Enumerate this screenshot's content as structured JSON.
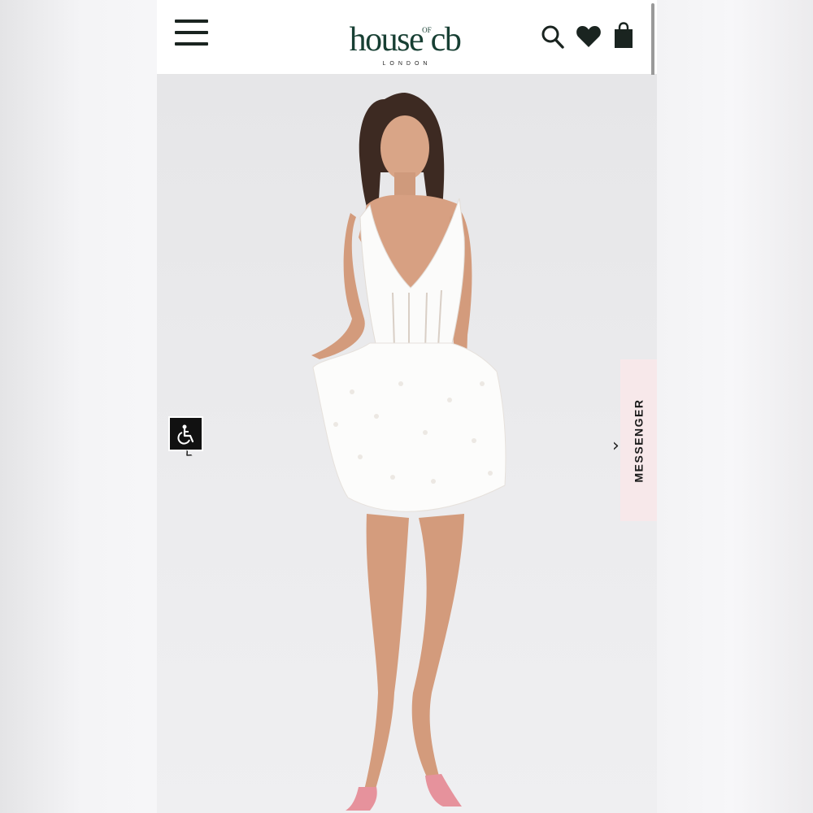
{
  "header": {
    "logo_text": "house",
    "logo_of": "OF",
    "logo_text_end": "cb",
    "logo_sub": "LONDON",
    "icons": [
      "menu-icon",
      "search-icon",
      "heart-icon",
      "shopping-bag-icon"
    ]
  },
  "product": {
    "image_alt": "Model wearing white broderie mini dress with corset bodice"
  },
  "widgets": {
    "messenger_label": "MESSENGER",
    "accessibility_icon": "wheelchair-icon",
    "prev_arrow": "‹",
    "next_arrow": "›"
  },
  "colors": {
    "brand": "#173f33",
    "messenger_bg": "#f7e8ea",
    "header_bg": "#ffffff"
  }
}
